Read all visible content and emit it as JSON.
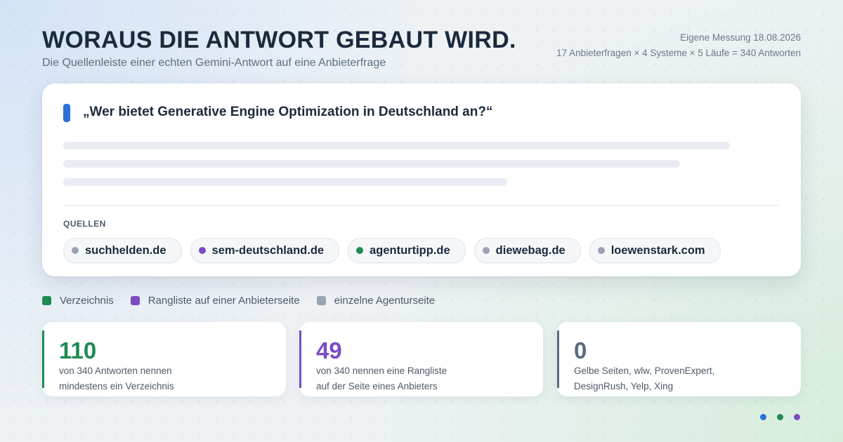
{
  "header": {
    "title": "WORAUS DIE ANTWORT GEBAUT WIRD.",
    "subtitle": "Die Quellenleiste einer echten Gemini-Antwort auf eine Anbieterfrage",
    "meta_line1": "Eigene Messung 18.08.2026",
    "meta_line2": "17 Anbieterfragen × 4 Systeme × 5 Läufe = 340 Antworten"
  },
  "answer_card": {
    "question": "„Wer bietet Generative Engine Optimization in Deutschland an?“",
    "question_marker_color": "#2a72d6",
    "sources_label": "QUELLEN",
    "sources": [
      {
        "label": "suchhelden.de",
        "type": "agency",
        "dot_color": "#9aa3b2"
      },
      {
        "label": "sem-deutschland.de",
        "type": "ranking",
        "dot_color": "#7b4bc4"
      },
      {
        "label": "agenturtipp.de",
        "type": "directory",
        "dot_color": "#1f8a52"
      },
      {
        "label": "diewebag.de",
        "type": "agency",
        "dot_color": "#9aa3b2"
      },
      {
        "label": "loewenstark.com",
        "type": "agency",
        "dot_color": "#9aa3b2"
      }
    ]
  },
  "legend": [
    {
      "label": "Verzeichnis",
      "color": "#1f8a52"
    },
    {
      "label": "Rangliste auf einer Anbieterseite",
      "color": "#7b4bc4"
    },
    {
      "label": "einzelne Agenturseite",
      "color": "#9aa3b2"
    }
  ],
  "stats": [
    {
      "value": "110",
      "description": "von 340 Antworten nennen\nmindestens ein Verzeichnis",
      "color": "#1f8a52"
    },
    {
      "value": "49",
      "description": "von 340 nennen eine Rangliste\nauf der Seite eines Anbieters",
      "color": "#7b4bc4"
    },
    {
      "value": "0",
      "description": "Gelbe Seiten, wlw, ProvenExpert,\nDesignRush, Yelp, Xing",
      "color": "#5b6b80"
    }
  ],
  "pagination_dots": [
    "#2a72d6",
    "#1f8a52",
    "#7b4bc4"
  ]
}
